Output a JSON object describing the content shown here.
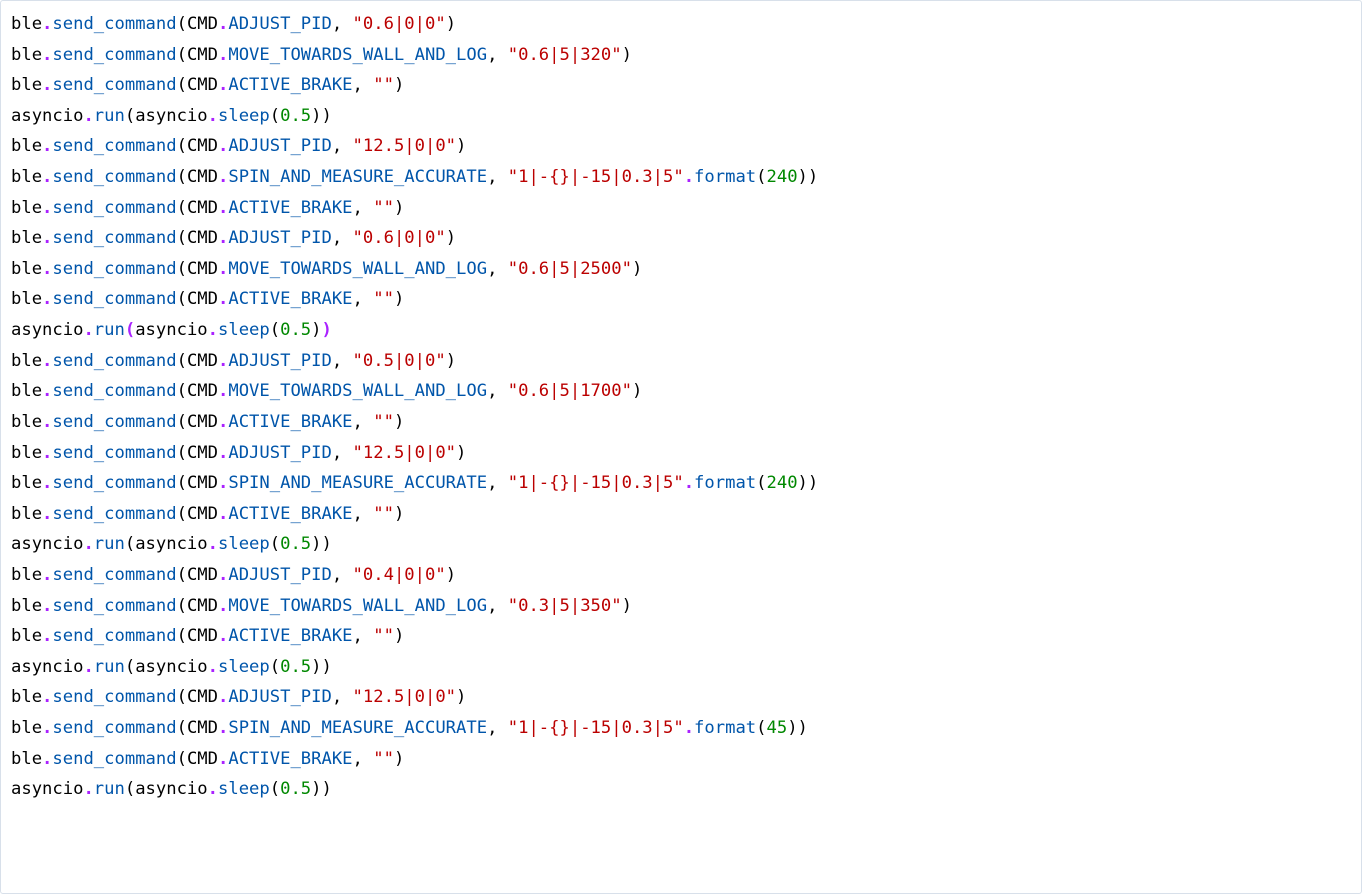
{
  "code": {
    "lines": [
      [
        {
          "t": "ble",
          "c": "o"
        },
        {
          "t": ".",
          "c": "p"
        },
        {
          "t": "send_command",
          "c": "m"
        },
        {
          "t": "(CMD",
          "c": "o"
        },
        {
          "t": ".",
          "c": "p"
        },
        {
          "t": "ADJUST_PID",
          "c": "m"
        },
        {
          "t": ", ",
          "c": "o"
        },
        {
          "t": "\"0.6|0|0\"",
          "c": "s"
        },
        {
          "t": ")",
          "c": "o"
        }
      ],
      [
        {
          "t": "ble",
          "c": "o"
        },
        {
          "t": ".",
          "c": "p"
        },
        {
          "t": "send_command",
          "c": "m"
        },
        {
          "t": "(CMD",
          "c": "o"
        },
        {
          "t": ".",
          "c": "p"
        },
        {
          "t": "MOVE_TOWARDS_WALL_AND_LOG",
          "c": "m"
        },
        {
          "t": ", ",
          "c": "o"
        },
        {
          "t": "\"0.6|5|320\"",
          "c": "s"
        },
        {
          "t": ")",
          "c": "o"
        }
      ],
      [
        {
          "t": "ble",
          "c": "o"
        },
        {
          "t": ".",
          "c": "p"
        },
        {
          "t": "send_command",
          "c": "m"
        },
        {
          "t": "(CMD",
          "c": "o"
        },
        {
          "t": ".",
          "c": "p"
        },
        {
          "t": "ACTIVE_BRAKE",
          "c": "m"
        },
        {
          "t": ", ",
          "c": "o"
        },
        {
          "t": "\"\"",
          "c": "s"
        },
        {
          "t": ")",
          "c": "o"
        }
      ],
      [
        {
          "t": "asyncio",
          "c": "o"
        },
        {
          "t": ".",
          "c": "p"
        },
        {
          "t": "run",
          "c": "m"
        },
        {
          "t": "(asyncio",
          "c": "o"
        },
        {
          "t": ".",
          "c": "p"
        },
        {
          "t": "sleep",
          "c": "m"
        },
        {
          "t": "(",
          "c": "o"
        },
        {
          "t": "0.5",
          "c": "n"
        },
        {
          "t": "))",
          "c": "o"
        }
      ],
      [
        {
          "t": "ble",
          "c": "o"
        },
        {
          "t": ".",
          "c": "p"
        },
        {
          "t": "send_command",
          "c": "m"
        },
        {
          "t": "(CMD",
          "c": "o"
        },
        {
          "t": ".",
          "c": "p"
        },
        {
          "t": "ADJUST_PID",
          "c": "m"
        },
        {
          "t": ", ",
          "c": "o"
        },
        {
          "t": "\"12.5|0|0\"",
          "c": "s"
        },
        {
          "t": ")",
          "c": "o"
        }
      ],
      [
        {
          "t": "ble",
          "c": "o"
        },
        {
          "t": ".",
          "c": "p"
        },
        {
          "t": "send_command",
          "c": "m"
        },
        {
          "t": "(CMD",
          "c": "o"
        },
        {
          "t": ".",
          "c": "p"
        },
        {
          "t": "SPIN_AND_MEASURE_ACCURATE",
          "c": "m"
        },
        {
          "t": ", ",
          "c": "o"
        },
        {
          "t": "\"1|-{}|-15|0.3|5\"",
          "c": "s"
        },
        {
          "t": ".",
          "c": "p"
        },
        {
          "t": "format",
          "c": "m"
        },
        {
          "t": "(",
          "c": "o"
        },
        {
          "t": "240",
          "c": "n"
        },
        {
          "t": "))",
          "c": "o"
        }
      ],
      [
        {
          "t": "ble",
          "c": "o"
        },
        {
          "t": ".",
          "c": "p"
        },
        {
          "t": "send_command",
          "c": "m"
        },
        {
          "t": "(CMD",
          "c": "o"
        },
        {
          "t": ".",
          "c": "p"
        },
        {
          "t": "ACTIVE_BRAKE",
          "c": "m"
        },
        {
          "t": ", ",
          "c": "o"
        },
        {
          "t": "\"\"",
          "c": "s"
        },
        {
          "t": ")",
          "c": "o"
        }
      ],
      [
        {
          "t": "ble",
          "c": "o"
        },
        {
          "t": ".",
          "c": "p"
        },
        {
          "t": "send_command",
          "c": "m"
        },
        {
          "t": "(CMD",
          "c": "o"
        },
        {
          "t": ".",
          "c": "p"
        },
        {
          "t": "ADJUST_PID",
          "c": "m"
        },
        {
          "t": ", ",
          "c": "o"
        },
        {
          "t": "\"0.6|0|0\"",
          "c": "s"
        },
        {
          "t": ")",
          "c": "o"
        }
      ],
      [
        {
          "t": "ble",
          "c": "o"
        },
        {
          "t": ".",
          "c": "p"
        },
        {
          "t": "send_command",
          "c": "m"
        },
        {
          "t": "(CMD",
          "c": "o"
        },
        {
          "t": ".",
          "c": "p"
        },
        {
          "t": "MOVE_TOWARDS_WALL_AND_LOG",
          "c": "m"
        },
        {
          "t": ", ",
          "c": "o"
        },
        {
          "t": "\"0.6|5|2500\"",
          "c": "s"
        },
        {
          "t": ")",
          "c": "o"
        }
      ],
      [
        {
          "t": "ble",
          "c": "o"
        },
        {
          "t": ".",
          "c": "p"
        },
        {
          "t": "send_command",
          "c": "m"
        },
        {
          "t": "(CMD",
          "c": "o"
        },
        {
          "t": ".",
          "c": "p"
        },
        {
          "t": "ACTIVE_BRAKE",
          "c": "m"
        },
        {
          "t": ", ",
          "c": "o"
        },
        {
          "t": "\"\"",
          "c": "s"
        },
        {
          "t": ")",
          "c": "o"
        }
      ],
      [
        {
          "t": "asyncio",
          "c": "o"
        },
        {
          "t": ".",
          "c": "p"
        },
        {
          "t": "run",
          "c": "m"
        },
        {
          "t": "(",
          "c": "pr"
        },
        {
          "t": "asyncio",
          "c": "o"
        },
        {
          "t": ".",
          "c": "p"
        },
        {
          "t": "sleep",
          "c": "m"
        },
        {
          "t": "(",
          "c": "o"
        },
        {
          "t": "0.5",
          "c": "n"
        },
        {
          "t": ")",
          "c": "o"
        },
        {
          "t": ")",
          "c": "pr"
        }
      ],
      [
        {
          "t": "ble",
          "c": "o"
        },
        {
          "t": ".",
          "c": "p"
        },
        {
          "t": "send_command",
          "c": "m"
        },
        {
          "t": "(CMD",
          "c": "o"
        },
        {
          "t": ".",
          "c": "p"
        },
        {
          "t": "ADJUST_PID",
          "c": "m"
        },
        {
          "t": ", ",
          "c": "o"
        },
        {
          "t": "\"0.5|0|0\"",
          "c": "s"
        },
        {
          "t": ")",
          "c": "o"
        }
      ],
      [
        {
          "t": "ble",
          "c": "o"
        },
        {
          "t": ".",
          "c": "p"
        },
        {
          "t": "send_command",
          "c": "m"
        },
        {
          "t": "(CMD",
          "c": "o"
        },
        {
          "t": ".",
          "c": "p"
        },
        {
          "t": "MOVE_TOWARDS_WALL_AND_LOG",
          "c": "m"
        },
        {
          "t": ", ",
          "c": "o"
        },
        {
          "t": "\"0.6|5|1700\"",
          "c": "s"
        },
        {
          "t": ")",
          "c": "o"
        }
      ],
      [
        {
          "t": "ble",
          "c": "o"
        },
        {
          "t": ".",
          "c": "p"
        },
        {
          "t": "send_command",
          "c": "m"
        },
        {
          "t": "(CMD",
          "c": "o"
        },
        {
          "t": ".",
          "c": "p"
        },
        {
          "t": "ACTIVE_BRAKE",
          "c": "m"
        },
        {
          "t": ", ",
          "c": "o"
        },
        {
          "t": "\"\"",
          "c": "s"
        },
        {
          "t": ")",
          "c": "o"
        }
      ],
      [
        {
          "t": "ble",
          "c": "o"
        },
        {
          "t": ".",
          "c": "p"
        },
        {
          "t": "send_command",
          "c": "m"
        },
        {
          "t": "(CMD",
          "c": "o"
        },
        {
          "t": ".",
          "c": "p"
        },
        {
          "t": "ADJUST_PID",
          "c": "m"
        },
        {
          "t": ", ",
          "c": "o"
        },
        {
          "t": "\"12.5|0|0\"",
          "c": "s"
        },
        {
          "t": ")",
          "c": "o"
        }
      ],
      [
        {
          "t": "ble",
          "c": "o"
        },
        {
          "t": ".",
          "c": "p"
        },
        {
          "t": "send_command",
          "c": "m"
        },
        {
          "t": "(CMD",
          "c": "o"
        },
        {
          "t": ".",
          "c": "p"
        },
        {
          "t": "SPIN_AND_MEASURE_ACCURATE",
          "c": "m"
        },
        {
          "t": ", ",
          "c": "o"
        },
        {
          "t": "\"1|-{}|-15|0.3|5\"",
          "c": "s"
        },
        {
          "t": ".",
          "c": "p"
        },
        {
          "t": "format",
          "c": "m"
        },
        {
          "t": "(",
          "c": "o"
        },
        {
          "t": "240",
          "c": "n"
        },
        {
          "t": "))",
          "c": "o"
        }
      ],
      [
        {
          "t": "ble",
          "c": "o"
        },
        {
          "t": ".",
          "c": "p"
        },
        {
          "t": "send_command",
          "c": "m"
        },
        {
          "t": "(CMD",
          "c": "o"
        },
        {
          "t": ".",
          "c": "p"
        },
        {
          "t": "ACTIVE_BRAKE",
          "c": "m"
        },
        {
          "t": ", ",
          "c": "o"
        },
        {
          "t": "\"\"",
          "c": "s"
        },
        {
          "t": ")",
          "c": "o"
        }
      ],
      [
        {
          "t": "asyncio",
          "c": "o"
        },
        {
          "t": ".",
          "c": "p"
        },
        {
          "t": "run",
          "c": "m"
        },
        {
          "t": "(asyncio",
          "c": "o"
        },
        {
          "t": ".",
          "c": "p"
        },
        {
          "t": "sleep",
          "c": "m"
        },
        {
          "t": "(",
          "c": "o"
        },
        {
          "t": "0.5",
          "c": "n"
        },
        {
          "t": "))",
          "c": "o"
        }
      ],
      [
        {
          "t": "ble",
          "c": "o"
        },
        {
          "t": ".",
          "c": "p"
        },
        {
          "t": "send_command",
          "c": "m"
        },
        {
          "t": "(CMD",
          "c": "o"
        },
        {
          "t": ".",
          "c": "p"
        },
        {
          "t": "ADJUST_PID",
          "c": "m"
        },
        {
          "t": ", ",
          "c": "o"
        },
        {
          "t": "\"0.4|0|0\"",
          "c": "s"
        },
        {
          "t": ")",
          "c": "o"
        }
      ],
      [
        {
          "t": "ble",
          "c": "o"
        },
        {
          "t": ".",
          "c": "p"
        },
        {
          "t": "send_command",
          "c": "m"
        },
        {
          "t": "(CMD",
          "c": "o"
        },
        {
          "t": ".",
          "c": "p"
        },
        {
          "t": "MOVE_TOWARDS_WALL_AND_LOG",
          "c": "m"
        },
        {
          "t": ", ",
          "c": "o"
        },
        {
          "t": "\"0.3|5|350\"",
          "c": "s"
        },
        {
          "t": ")",
          "c": "o"
        }
      ],
      [
        {
          "t": "ble",
          "c": "o"
        },
        {
          "t": ".",
          "c": "p"
        },
        {
          "t": "send_command",
          "c": "m"
        },
        {
          "t": "(CMD",
          "c": "o"
        },
        {
          "t": ".",
          "c": "p"
        },
        {
          "t": "ACTIVE_BRAKE",
          "c": "m"
        },
        {
          "t": ", ",
          "c": "o"
        },
        {
          "t": "\"\"",
          "c": "s"
        },
        {
          "t": ")",
          "c": "o"
        }
      ],
      [
        {
          "t": "asyncio",
          "c": "o"
        },
        {
          "t": ".",
          "c": "p"
        },
        {
          "t": "run",
          "c": "m"
        },
        {
          "t": "(asyncio",
          "c": "o"
        },
        {
          "t": ".",
          "c": "p"
        },
        {
          "t": "sleep",
          "c": "m"
        },
        {
          "t": "(",
          "c": "o"
        },
        {
          "t": "0.5",
          "c": "n"
        },
        {
          "t": "))",
          "c": "o"
        }
      ],
      [
        {
          "t": "ble",
          "c": "o"
        },
        {
          "t": ".",
          "c": "p"
        },
        {
          "t": "send_command",
          "c": "m"
        },
        {
          "t": "(CMD",
          "c": "o"
        },
        {
          "t": ".",
          "c": "p"
        },
        {
          "t": "ADJUST_PID",
          "c": "m"
        },
        {
          "t": ", ",
          "c": "o"
        },
        {
          "t": "\"12.5|0|0\"",
          "c": "s"
        },
        {
          "t": ")",
          "c": "o"
        }
      ],
      [
        {
          "t": "ble",
          "c": "o"
        },
        {
          "t": ".",
          "c": "p"
        },
        {
          "t": "send_command",
          "c": "m"
        },
        {
          "t": "(CMD",
          "c": "o"
        },
        {
          "t": ".",
          "c": "p"
        },
        {
          "t": "SPIN_AND_MEASURE_ACCURATE",
          "c": "m"
        },
        {
          "t": ", ",
          "c": "o"
        },
        {
          "t": "\"1|-{}|-15|0.3|5\"",
          "c": "s"
        },
        {
          "t": ".",
          "c": "p"
        },
        {
          "t": "format",
          "c": "m"
        },
        {
          "t": "(",
          "c": "o"
        },
        {
          "t": "45",
          "c": "n"
        },
        {
          "t": "))",
          "c": "o"
        }
      ],
      [
        {
          "t": "ble",
          "c": "o"
        },
        {
          "t": ".",
          "c": "p"
        },
        {
          "t": "send_command",
          "c": "m"
        },
        {
          "t": "(CMD",
          "c": "o"
        },
        {
          "t": ".",
          "c": "p"
        },
        {
          "t": "ACTIVE_BRAKE",
          "c": "m"
        },
        {
          "t": ", ",
          "c": "o"
        },
        {
          "t": "\"\"",
          "c": "s"
        },
        {
          "t": ")",
          "c": "o"
        }
      ],
      [
        {
          "t": "asyncio",
          "c": "o"
        },
        {
          "t": ".",
          "c": "p"
        },
        {
          "t": "run",
          "c": "m"
        },
        {
          "t": "(asyncio",
          "c": "o"
        },
        {
          "t": ".",
          "c": "p"
        },
        {
          "t": "sleep",
          "c": "m"
        },
        {
          "t": "(",
          "c": "o"
        },
        {
          "t": "0.5",
          "c": "n"
        },
        {
          "t": "))",
          "c": "o"
        }
      ]
    ]
  }
}
